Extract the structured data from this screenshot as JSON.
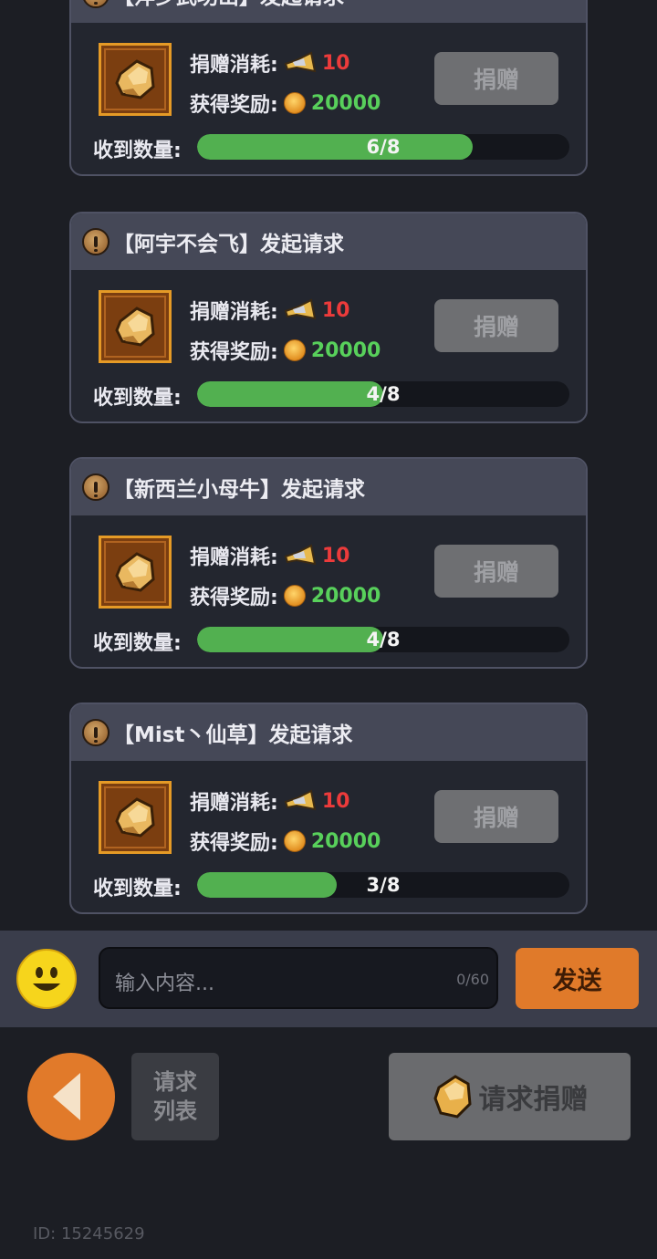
{
  "requests": [
    {
      "title": "【萍乡武功山】发起请求",
      "cost_label": "捐赠消耗:",
      "cost": "10",
      "reward_label": "获得奖励:",
      "reward": "20000",
      "donate_label": "捐赠",
      "recv_label": "收到数量:",
      "progress_text": "6/8",
      "progress": 0.75
    },
    {
      "title": "【阿宇不会飞】发起请求",
      "cost_label": "捐赠消耗:",
      "cost": "10",
      "reward_label": "获得奖励:",
      "reward": "20000",
      "donate_label": "捐赠",
      "recv_label": "收到数量:",
      "progress_text": "4/8",
      "progress": 0.5
    },
    {
      "title": "【新西兰小母牛】发起请求",
      "cost_label": "捐赠消耗:",
      "cost": "10",
      "reward_label": "获得奖励:",
      "reward": "20000",
      "donate_label": "捐赠",
      "recv_label": "收到数量:",
      "progress_text": "4/8",
      "progress": 0.5
    },
    {
      "title": "【Mist丶仙草】发起请求",
      "cost_label": "捐赠消耗:",
      "cost": "10",
      "reward_label": "获得奖励:",
      "reward": "20000",
      "donate_label": "捐赠",
      "recv_label": "收到数量:",
      "progress_text": "3/8",
      "progress": 0.375
    }
  ],
  "chat": {
    "placeholder": "输入内容...",
    "counter": "0/60",
    "send_label": "发送"
  },
  "footer": {
    "request_list_line1": "请求",
    "request_list_line2": "列表",
    "request_donation_label": "请求捐赠",
    "user_id": "ID: 15245629"
  },
  "colors": {
    "cost": "#ec3b3b",
    "reward": "#58d05b",
    "progress": "#52b050",
    "send_button": "#e07a2a",
    "back_button": "#e17a2a"
  },
  "icons": [
    "warning-icon",
    "ore-icon",
    "horn-icon",
    "coin-icon",
    "emoji-icon",
    "back-arrow-icon"
  ]
}
